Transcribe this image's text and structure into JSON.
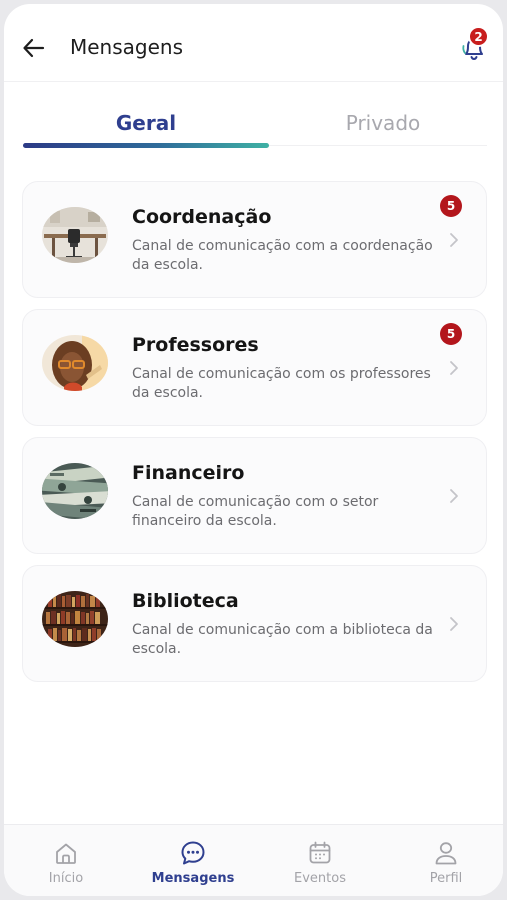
{
  "header": {
    "title": "Mensagens",
    "notification_count": "2"
  },
  "tabs": [
    {
      "label": "Geral",
      "active": true
    },
    {
      "label": "Privado",
      "active": false
    }
  ],
  "channels": [
    {
      "title": "Coordenação",
      "description": "Canal de comunicação com a coordenação da escola.",
      "badge": "5",
      "avatar": "office-desk-image"
    },
    {
      "title": "Professores",
      "description": "Canal de comunicação com os professores da escola.",
      "badge": "5",
      "avatar": "teacher-portrait-image"
    },
    {
      "title": "Financeiro",
      "description": "Canal de comunicação com o setor financeiro da escola.",
      "badge": "",
      "avatar": "money-bills-image"
    },
    {
      "title": "Biblioteca",
      "description": "Canal de comunicação com a biblioteca da escola.",
      "badge": "",
      "avatar": "bookshelf-image"
    }
  ],
  "bottom_nav": [
    {
      "label": "Início",
      "icon": "home-icon",
      "active": false
    },
    {
      "label": "Mensagens",
      "icon": "chat-icon",
      "active": true
    },
    {
      "label": "Eventos",
      "icon": "calendar-icon",
      "active": false
    },
    {
      "label": "Perfil",
      "icon": "user-icon",
      "active": false
    }
  ],
  "colors": {
    "primary": "#2f3f8f",
    "accent_gradient_end": "#3fb1a4",
    "badge_red": "#c81e1e",
    "inactive": "#a3a3a8"
  }
}
